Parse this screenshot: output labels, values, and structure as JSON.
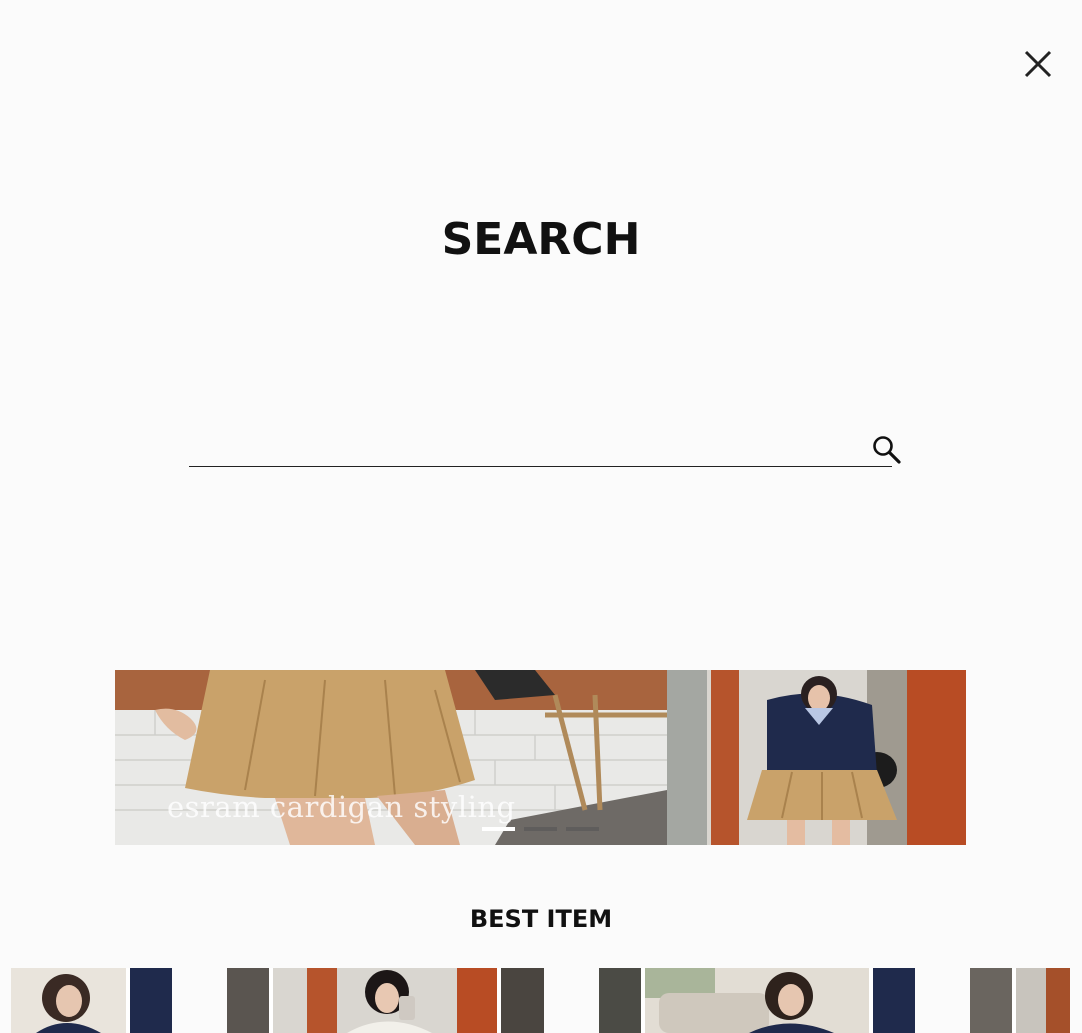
{
  "page": {
    "title": "SEARCH"
  },
  "search": {
    "value": "",
    "placeholder": "",
    "icon": "search-icon"
  },
  "close": {
    "icon": "close-icon"
  },
  "banner": {
    "caption": "esram cardigan styling",
    "slide_count": 3,
    "active_slide": 1
  },
  "best_item": {
    "title": "BEST ITEM"
  },
  "colors": {
    "background": "#fbfbfb",
    "text": "#111111",
    "skirt": "#c9a26a",
    "cardigan": "#1f2a4c"
  }
}
